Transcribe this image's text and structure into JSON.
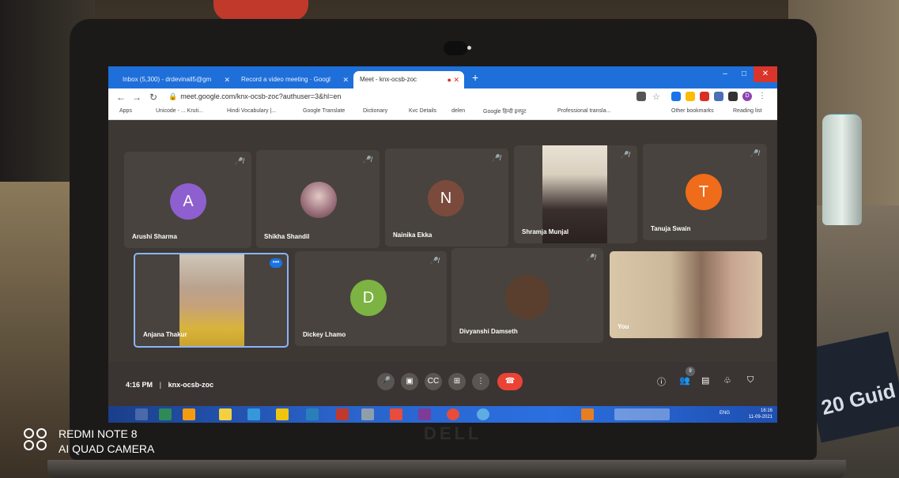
{
  "browser": {
    "tabs": [
      {
        "label": "Inbox (5,300) - drdevinall5@gm",
        "active": false
      },
      {
        "label": "Record a video meeting · Googl",
        "active": false
      },
      {
        "label": "Meet - knx-ocsb-zoc",
        "active": true
      }
    ],
    "url": "meet.google.com/knx-ocsb-zoc?authuser=3&hl=en",
    "bookmarks": [
      "Apps",
      "Unicode - ... Kruti...",
      "Hindi Vocabulary |...",
      "Google Translate",
      "Dictionary",
      "Kvc Details",
      "delen",
      "Google हिन्दी इनपुट",
      "Professional transla...",
      "Other bookmarks",
      "Reading list"
    ],
    "profile_initial": "D"
  },
  "meet": {
    "participants": [
      {
        "name": "Arushi Sharma",
        "initial": "A",
        "avatar_color": "#8e5fcf",
        "muted": true
      },
      {
        "name": "Shikha Shandil",
        "initial": "",
        "avatar_color": "#9a6e7a",
        "muted": true
      },
      {
        "name": "Nainika Ekka",
        "initial": "N",
        "avatar_color": "#7a4a3c",
        "muted": true
      },
      {
        "name": "Shramja Munjal",
        "initial": "",
        "muted": true
      },
      {
        "name": "Tanuja Swain",
        "initial": "T",
        "avatar_color": "#ef6c1a",
        "muted": true
      },
      {
        "name": "Anjana Thakur",
        "initial": "",
        "muted": false
      },
      {
        "name": "Dickey Lhamo",
        "initial": "D",
        "avatar_color": "#7cb342",
        "muted": true
      },
      {
        "name": "Divyanshi Damseth",
        "initial": "",
        "avatar_color": "#5a3f2e",
        "muted": true
      },
      {
        "name": "You",
        "initial": "",
        "muted": false
      }
    ],
    "time": "4:16 PM",
    "separator": "|",
    "meeting_code": "knx-ocsb-zoc",
    "people_count": "9",
    "more_label": "•••"
  },
  "taskbar": {
    "language": "ENG",
    "clock_time": "16:16",
    "clock_date": "11-09-2021"
  },
  "laptop_brand": "DELL",
  "book_text": "20 Guid",
  "watermark": {
    "line1": "REDMI NOTE 8",
    "line2": "AI QUAD CAMERA"
  },
  "colors": {
    "chrome_blue": "#1e6fd9",
    "meet_bg": "#3d3834",
    "end_call": "#ea4335",
    "accent_blue": "#1a73e8"
  }
}
